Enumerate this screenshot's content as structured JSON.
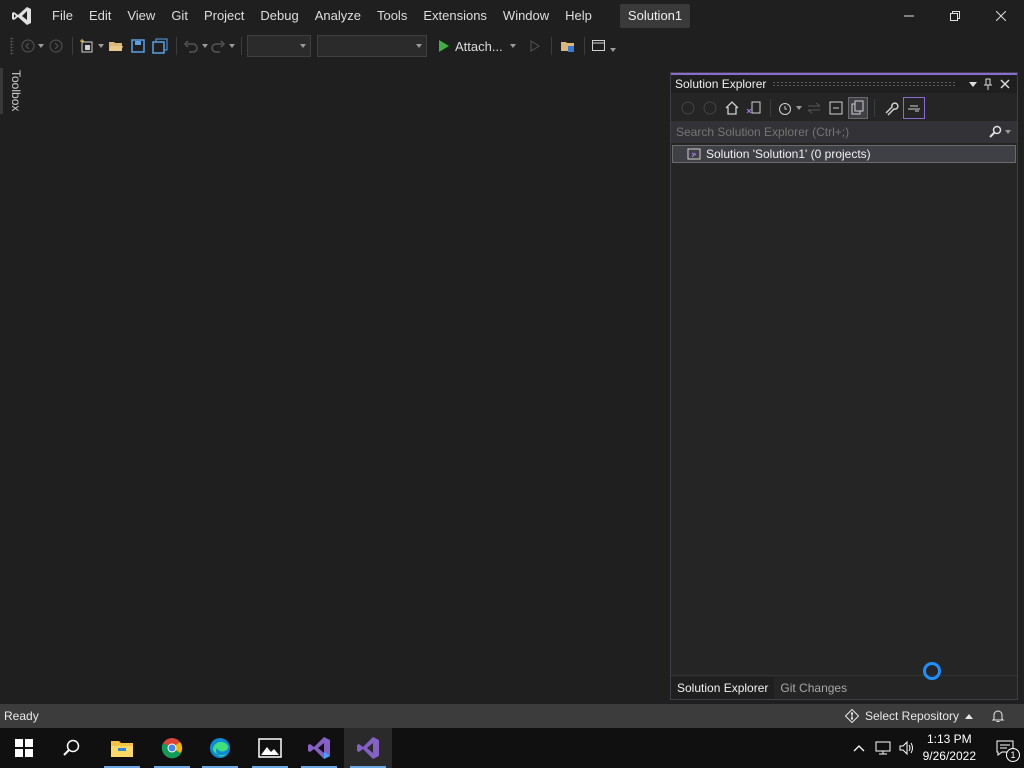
{
  "menu": {
    "items": [
      "File",
      "Edit",
      "View",
      "Git",
      "Project",
      "Debug",
      "Analyze",
      "Tools",
      "Extensions",
      "Window",
      "Help"
    ],
    "solution_name": "Solution1"
  },
  "toolbar": {
    "attach_label": "Attach..."
  },
  "toolbox": {
    "label": "Toolbox"
  },
  "solution_explorer": {
    "title": "Solution Explorer",
    "search_placeholder": "Search Solution Explorer (Ctrl+;)",
    "solution_row": "Solution 'Solution1' (0 projects)",
    "tabs": [
      "Solution Explorer",
      "Git Changes"
    ]
  },
  "statusbar": {
    "status": "Ready",
    "repo": "Select Repository"
  },
  "taskbar": {
    "time": "1:13 PM",
    "date": "9/26/2022",
    "notification_count": "1"
  },
  "colors": {
    "accent": "#8a6cd0",
    "background": "#1f1f1f",
    "statusbar": "#3c3c3c",
    "spinner": "#1e90ff"
  }
}
